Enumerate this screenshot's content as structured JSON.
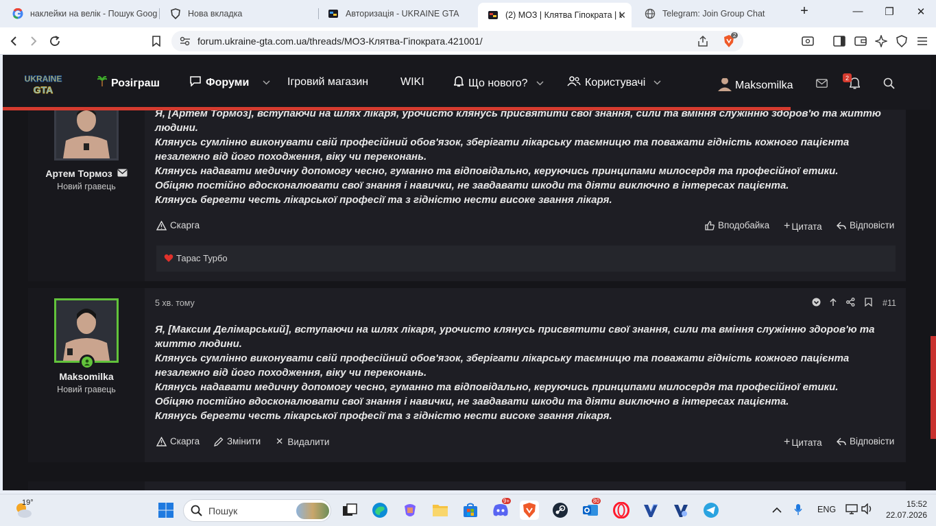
{
  "browser": {
    "tabs": [
      {
        "title": "наклейки на велік - Пошук Goog"
      },
      {
        "title": "Нова вкладка"
      },
      {
        "title": "Авторизація - UKRAINE GTA"
      },
      {
        "title": "(2) МОЗ | Клятва Гіпократа | U"
      },
      {
        "title": "Telegram: Join Group Chat"
      }
    ],
    "url": "forum.ukraine-gta.com.ua/threads/МОЗ-Клятва-Гіпократа.421001/",
    "brave_badge": "2"
  },
  "site": {
    "logo_top": "UKRAINE",
    "logo_bottom": "GTA",
    "nav": {
      "giveaway": "Розіграш",
      "forums": "Форуми",
      "shop": "Ігровий магазин",
      "wiki": "WIKI",
      "whats_new": "Що нового?",
      "users": "Користувачі"
    },
    "username": "Maksomilka",
    "alerts_count": "2"
  },
  "post1": {
    "author": "Артем Тормоз",
    "author_title": "Новий гравець",
    "lines": [
      "Я, [Артем Тормоз], вступаючи на шлях лікаря, урочисто клянусь присвятити свої знання, сили та вміння служінню здоров'ю та життю людини.",
      "Клянусь сумлінно виконувати свій професійний обов'язок, зберігати лікарську таємницю та поважати гідність кожного пацієнта незалежно від його походження, віку чи переконань.",
      "Клянусь надавати медичну допомогу чесно, гуманно та відповідально, керуючись принципами милосердя та професійної етики.",
      "Обіцяю постійно вдосконалювати свої знання і навички, не завдавати шкоди та діяти виключно в інтересах пацієнта.",
      "Клянусь берегти честь лікарської професії та з гідністю нести високе звання лікаря."
    ],
    "report": "Скарга",
    "like": "Вподобайка",
    "quote": "Цитата",
    "reply": "Відповісти",
    "reaction_user": "Тарас Турбо"
  },
  "post2": {
    "author": "Maksomilka",
    "author_title": "Новий гравець",
    "time": "5 хв. тому",
    "number": "#11",
    "lines": [
      "Я, [Максим Делімарський], вступаючи на шлях лікаря, урочисто клянусь присвятити свої знання, сили та вміння служінню здоров'ю та життю людини.",
      "Клянусь сумлінно виконувати свій професійний обов'язок, зберігати лікарську таємницю та поважати гідність кожного пацієнта незалежно від його походження, віку чи переконань.",
      "Клянусь надавати медичну допомогу чесно, гуманно та відповідально, керуючись принципами милосердя та професійної етики.",
      "Обіцяю постійно вдосконалювати свої знання і навички, не завдавати шкоди та діяти виключно в інтересах пацієнта.",
      "Клянусь берегти честь лікарської професії та з гідністю нести високе звання лікаря."
    ],
    "report": "Скарга",
    "edit": "Змінити",
    "delete": "Видалити",
    "quote": "Цитата",
    "reply": "Відповісти"
  },
  "taskbar": {
    "weather": "19°",
    "search_placeholder": "Пошук",
    "discord_badge": "9+",
    "outlook_badge": "80",
    "lang": "ENG",
    "time": "15:52",
    "date": "22.07.2026"
  },
  "colors": {
    "accent_red": "#d53b2f",
    "online_green": "#62c33b"
  }
}
